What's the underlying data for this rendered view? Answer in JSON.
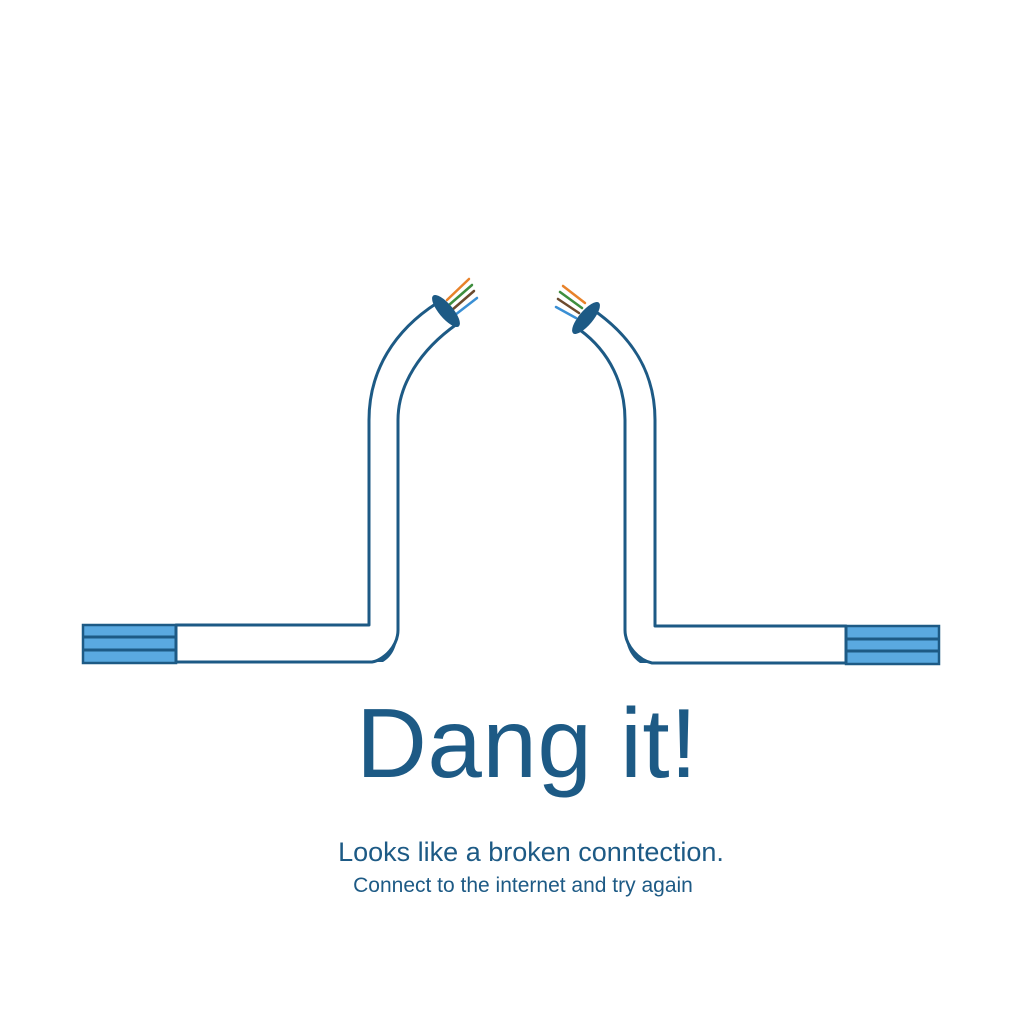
{
  "error": {
    "headline": "Dang it!",
    "message": "Looks like a broken conntection.",
    "submessage": "Connect to the internet and try again"
  },
  "illustration": {
    "name": "broken-network-cable",
    "colors": {
      "cable_outline": "#1d5a85",
      "connector_fill": "#5aa9e0",
      "wire_orange": "#e8822a",
      "wire_green": "#3e8e3e",
      "wire_brown": "#6b4a2e",
      "wire_blue": "#3a8fd4"
    }
  }
}
